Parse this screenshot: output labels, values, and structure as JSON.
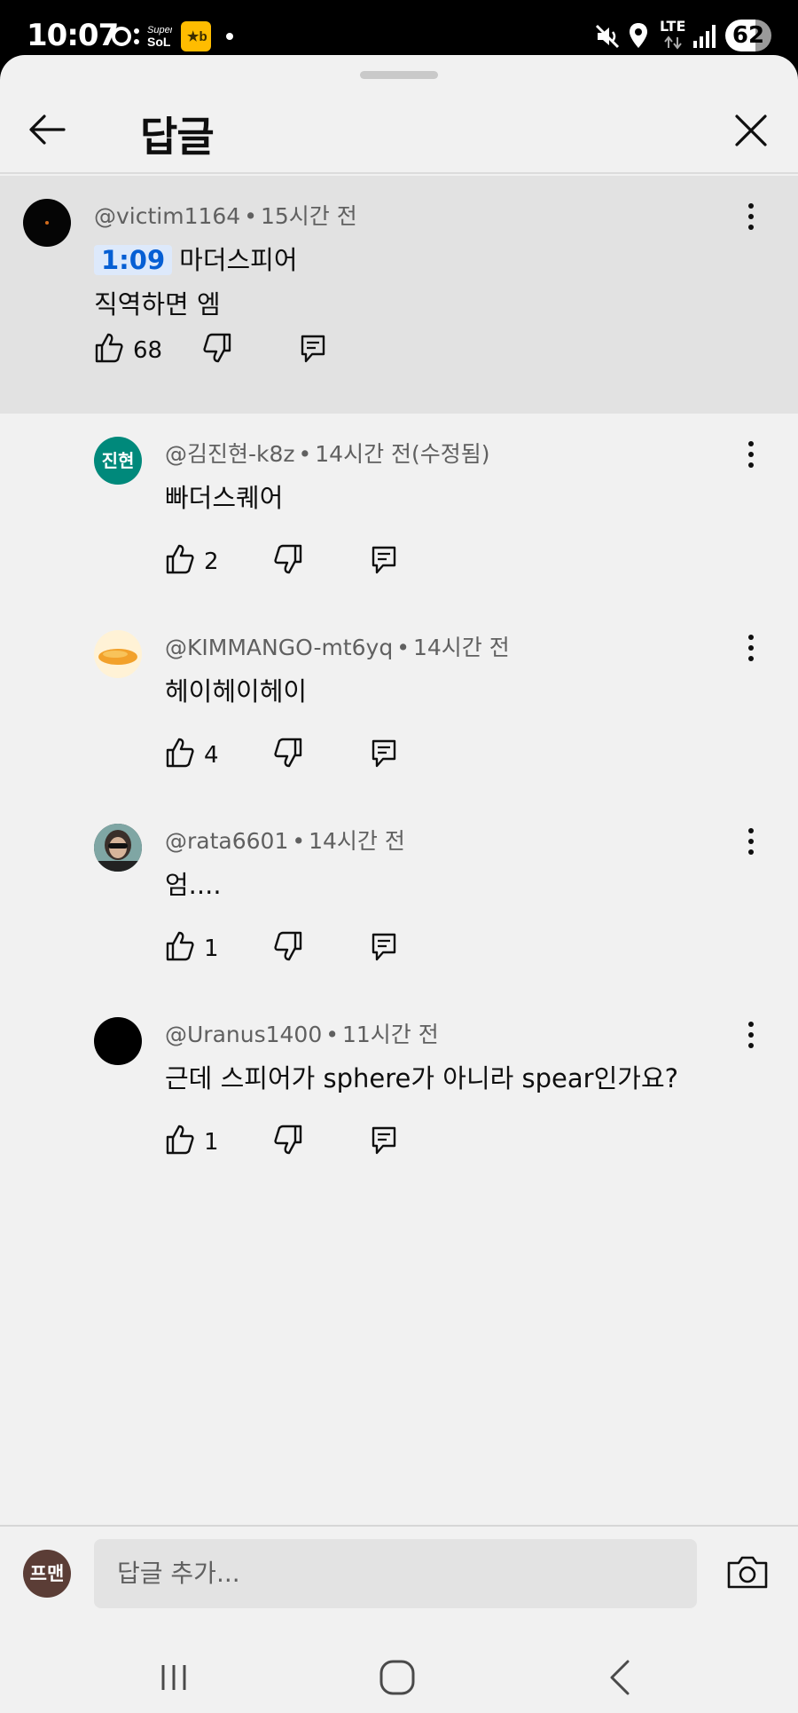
{
  "status_bar": {
    "time": "10:07",
    "battery": "62",
    "network": "LTE"
  },
  "header": {
    "title": "답글",
    "back_icon": "arrow-left-icon",
    "close_icon": "close-icon"
  },
  "comments": [
    {
      "author": "@victim1164",
      "time": "15시간 전",
      "timestamp": "1:09",
      "line1": "마더스피어",
      "line2": "직역하면 엠",
      "likes": "68",
      "avatar_color": "#050505"
    },
    {
      "author": "@김진현-k8z",
      "time": "14시간 전(수정됨)",
      "text": "빠더스퀘어",
      "likes": "2",
      "avatar_text": "진현",
      "avatar_color": "#00897b"
    },
    {
      "author": "@KIMMANGO-mt6yq",
      "time": "14시간 전",
      "text": "헤이헤이헤이",
      "likes": "4",
      "avatar_color": "#fff2d6"
    },
    {
      "author": "@rata6601",
      "time": "14시간 전",
      "text": "엄....",
      "likes": "1",
      "avatar_color": "#2e3a3a"
    },
    {
      "author": "@Uranus1400",
      "time": "11시간 전",
      "text": "근데 스피어가 sphere가 아니라 spear인가요?",
      "likes": "1",
      "avatar_color": "#000000"
    }
  ],
  "reply_bar": {
    "avatar_text": "프맨",
    "placeholder": "답글 추가...",
    "camera_icon": "camera-icon"
  },
  "nav": {
    "recents_icon": "recents-icon",
    "home_icon": "home-icon",
    "back_icon": "back-icon"
  },
  "separator": "•"
}
